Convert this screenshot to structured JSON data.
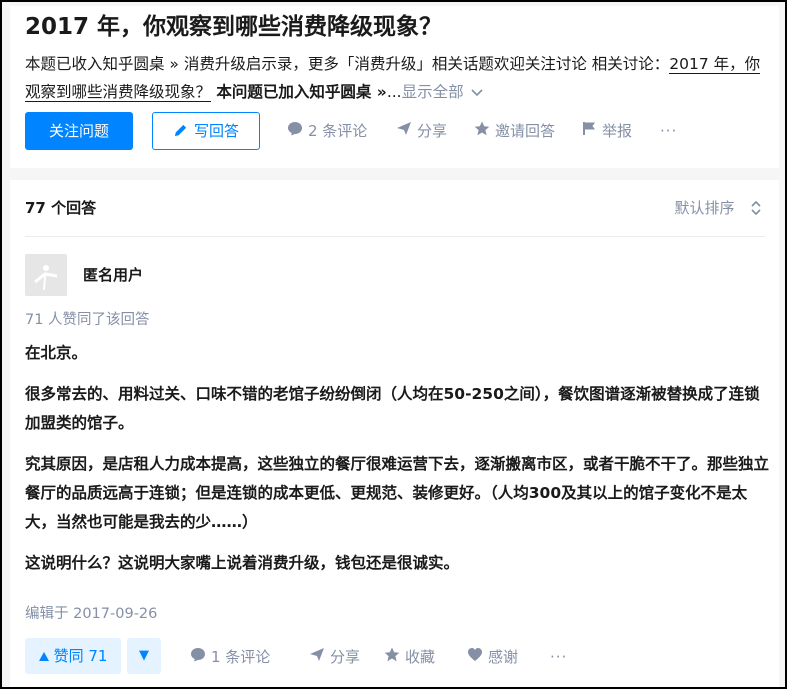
{
  "question": {
    "title": "2017 年，你观察到哪些消费降级现象？",
    "desc_prefix": "本题已收入知乎圆桌 » 消费升级启示录，更多「消费升级」相关话题欢迎关注讨论 相关讨论：",
    "desc_link": "2017 年，你观察到哪些消费降级现象？",
    "desc_bold": " 本问题已加入知乎圆桌 »",
    "desc_ellipsis": "...",
    "show_all": "显示全部",
    "follow_label": "关注问题",
    "write_label": "写回答",
    "comments_label": "2 条评论",
    "share_label": "分享",
    "invite_label": "邀请回答",
    "report_label": "举报",
    "more_label": "···"
  },
  "answers_header": {
    "count_label": "77 个回答",
    "sort_label": "默认排序"
  },
  "answer": {
    "author": "匿名用户",
    "votes_text": "71 人赞同了该回答",
    "paragraphs": [
      "在北京。",
      "很多常去的、用料过关、口味不错的老馆子纷纷倒闭（人均在50-250之间），餐饮图谱逐渐被替换成了连锁加盟类的馆子。",
      "究其原因，是店租人力成本提高，这些独立的餐厅很难运营下去，逐渐搬离市区，或者干脆不干了。那些独立餐厅的品质远高于连锁；但是连锁的成本更低、更规范、装修更好。（人均300及其以上的馆子变化不是太大，当然也可能是我去的少……）",
      "这说明什么？这说明大家嘴上说着消费升级，钱包还是很诚实。"
    ],
    "edited": "编辑于 2017-09-26",
    "upvote_label": "赞同 71",
    "downvote_icon": "▼",
    "comments_label": "1 条评论",
    "share_label": "分享",
    "collect_label": "收藏",
    "thanks_label": "感谢",
    "more_label": "···"
  },
  "colors": {
    "brand_blue": "#0084ff",
    "muted_gray": "#8590a6",
    "upvote_bg": "#e5f2ff"
  },
  "icons": [
    "pencil-icon",
    "comment-icon",
    "share-icon",
    "star-icon",
    "flag-icon",
    "chevron-down-icon",
    "sort-icon",
    "triangle-up-icon",
    "heart-icon",
    "avatar-icon"
  ]
}
